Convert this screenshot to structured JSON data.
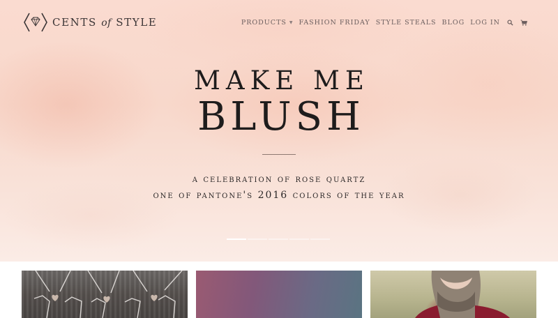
{
  "brand": {
    "logo_text_before": "CENTS",
    "logo_text_of": "of",
    "logo_text_after": "STYLE",
    "color": "#3b3536"
  },
  "nav": {
    "items": [
      {
        "label": "PRODUCTS",
        "has_dropdown": true
      },
      {
        "label": "FASHION FRIDAY"
      },
      {
        "label": "STYLE STEALS"
      },
      {
        "label": "BLOG"
      },
      {
        "label": "LOG IN"
      }
    ],
    "search_icon": "search-icon",
    "cart_icon": "cart-icon"
  },
  "hero": {
    "line1": "MAKE ME",
    "line2": "BLUSH",
    "subtitle_1": "a celebration of rose quartz",
    "subtitle_2": "one of pantone's 2016 colors of the year",
    "slide_count": 5,
    "active_slide": 1,
    "background_color": "#f8d8cb"
  },
  "tiles": [
    {
      "icon": "necklace-image"
    },
    {
      "icon": "gradient-image"
    },
    {
      "icon": "scarf-model-image"
    }
  ]
}
